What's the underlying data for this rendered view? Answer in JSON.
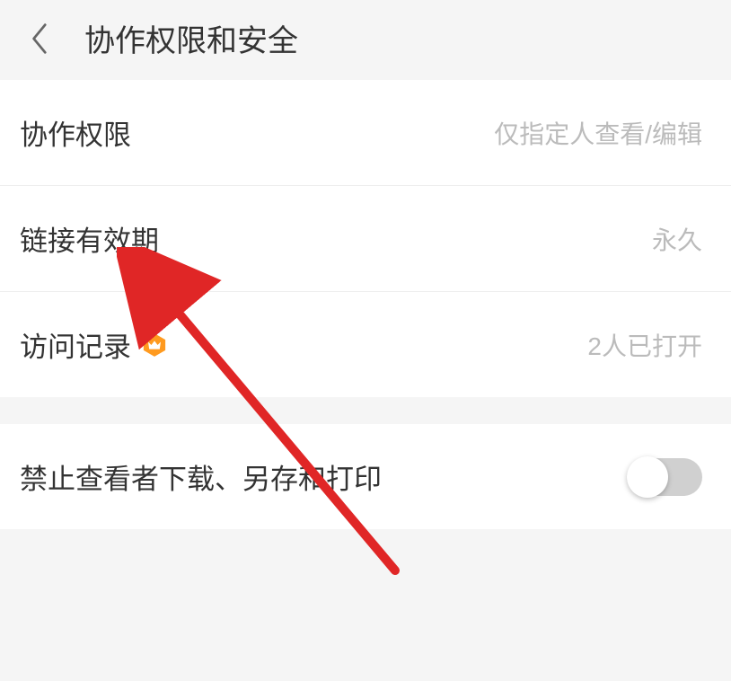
{
  "header": {
    "title": "协作权限和安全"
  },
  "rows": {
    "permission": {
      "label": "协作权限",
      "value": "仅指定人查看/编辑"
    },
    "expiry": {
      "label": "链接有效期",
      "value": "永久"
    },
    "access_log": {
      "label": "访问记录",
      "value": "2人已打开"
    },
    "restrict": {
      "label": "禁止查看者下载、另存和打印"
    }
  },
  "toggle": {
    "restrict_download": false
  },
  "icons": {
    "premium": "crown-icon"
  },
  "colors": {
    "accent": "#ff8c1a",
    "arrow": "#e02626"
  }
}
